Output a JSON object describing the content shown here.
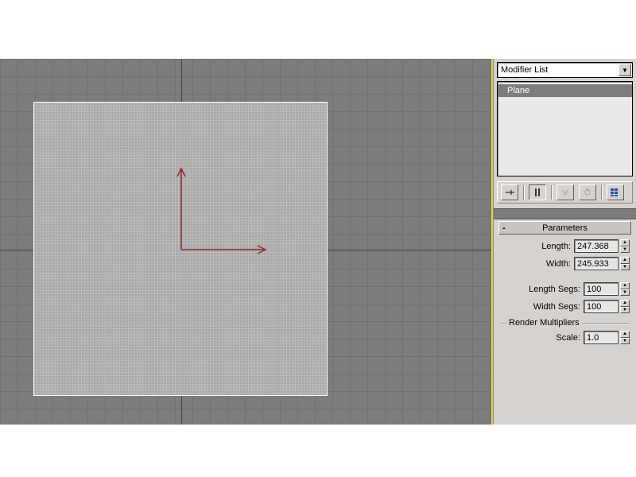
{
  "panel": {
    "modifier_dropdown": "Modifier List",
    "stack": {
      "item0": "Plane"
    },
    "rollout": {
      "title": "Parameters",
      "length_label": "Length:",
      "length_value": "247.368",
      "width_label": "Width:",
      "width_value": "245.933",
      "lsegs_label": "Length Segs:",
      "lsegs_value": "100",
      "wsegs_label": "Width Segs:",
      "wsegs_value": "100",
      "render_mult_label": "Render Multipliers",
      "scale_label": "Scale:",
      "scale_value": "1.0"
    }
  }
}
